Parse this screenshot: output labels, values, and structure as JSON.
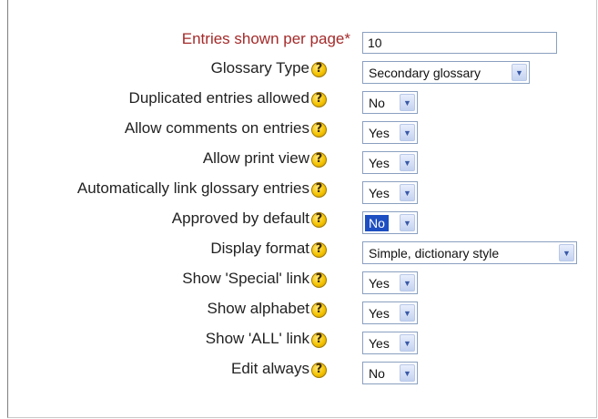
{
  "form": {
    "entries_per_page": {
      "label": "Entries shown per page*",
      "value": "10"
    },
    "glossary_type": {
      "label": "Glossary Type",
      "value": "Secondary glossary"
    },
    "duplicated_entries": {
      "label": "Duplicated entries allowed",
      "value": "No"
    },
    "allow_comments": {
      "label": "Allow comments on entries",
      "value": "Yes"
    },
    "allow_print": {
      "label": "Allow print view",
      "value": "Yes"
    },
    "auto_link": {
      "label": "Automatically link glossary entries",
      "value": "Yes"
    },
    "approved_default": {
      "label": "Approved by default",
      "value": "No"
    },
    "display_format": {
      "label": "Display format",
      "value": "Simple, dictionary style"
    },
    "show_special": {
      "label": "Show 'Special' link",
      "value": "Yes"
    },
    "show_alphabet": {
      "label": "Show alphabet",
      "value": "Yes"
    },
    "show_all": {
      "label": "Show 'ALL' link",
      "value": "Yes"
    },
    "edit_always": {
      "label": "Edit always",
      "value": "No"
    }
  },
  "icons": {
    "help": "help-icon",
    "dropdown": "chevron-down-icon"
  },
  "colors": {
    "required_label": "#a52a2a",
    "selected_highlight": "#1e4fc2"
  }
}
